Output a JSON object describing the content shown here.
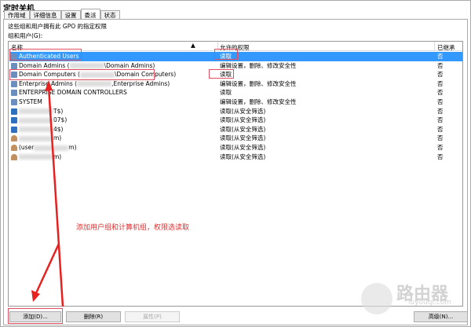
{
  "window": {
    "title": "定时关机"
  },
  "tabs": [
    "作用域",
    "详细信息",
    "设置",
    "委派",
    "状态"
  ],
  "active_tab": 3,
  "description": "这些组和用户拥有此 GPO 的指定权限",
  "group_label": "组和用户(G):",
  "columns": {
    "name": "名称",
    "permission": "允许的权限",
    "inherited": "已继承"
  },
  "rows": [
    {
      "pre": "Authenticated Users",
      "post": "",
      "perm": "读取",
      "inh": "否",
      "icon": "group"
    },
    {
      "pre": "Domain Admins (",
      "post": "\\Domain Admins)",
      "perm": "编辑设置，删除、修改安全性",
      "inh": "否",
      "icon": "group"
    },
    {
      "pre": "Domain Computers (",
      "post": "\\Domain Computers)",
      "perm": "读取",
      "inh": "否",
      "icon": "group"
    },
    {
      "pre": "Enterprise Admins (",
      "post": ",Enterprise Admins)",
      "perm": "编辑设置，删除、修改安全性",
      "inh": "否",
      "icon": "group"
    },
    {
      "pre": "ENTERPRISE DOMAIN CONTROLLERS",
      "post": "",
      "perm": "读取",
      "inh": "否",
      "icon": "group"
    },
    {
      "pre": "SYSTEM",
      "post": "",
      "perm": "编辑设置，删除、修改安全性",
      "inh": "否",
      "icon": "group"
    },
    {
      "pre": "",
      "post": "T$)",
      "perm": "读取(从安全筛选)",
      "inh": "否",
      "icon": "computer"
    },
    {
      "pre": "",
      "post": "07$)",
      "perm": "读取(从安全筛选)",
      "inh": "否",
      "icon": "computer"
    },
    {
      "pre": "",
      "post": "4$)",
      "perm": "读取(从安全筛选)",
      "inh": "否",
      "icon": "computer"
    },
    {
      "pre": "",
      "post": "m)",
      "perm": "读取(从安全筛选)",
      "inh": "否",
      "icon": "user"
    },
    {
      "pre": "(user",
      "post": "m)",
      "perm": "读取(从安全筛选)",
      "inh": "否",
      "icon": "user"
    },
    {
      "pre": "",
      "post": "m)",
      "perm": "读取(从安全筛选)",
      "inh": "否",
      "icon": "user"
    }
  ],
  "buttons": {
    "add": "添加(D)...",
    "remove": "删除(R)",
    "properties": "属性(P)",
    "advanced": "高级(N)..."
  },
  "annotation": "添加用户组和计算机组，权限选读取",
  "watermark": {
    "text": "路由器",
    "sub": "luyouqi.com"
  },
  "colors": {
    "selection": "#3399ff",
    "annotation": "#e03030"
  }
}
